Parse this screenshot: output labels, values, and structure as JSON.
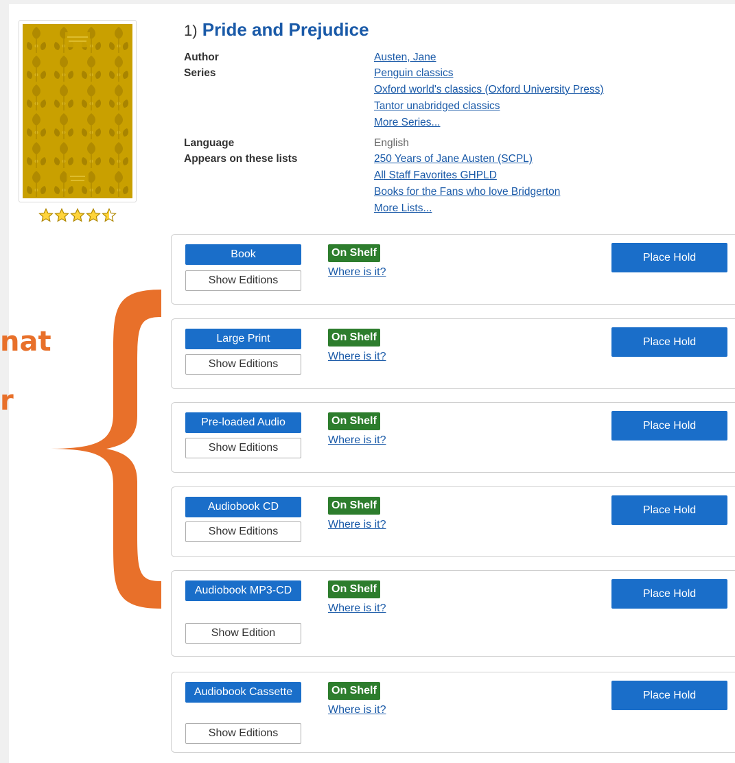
{
  "record": {
    "number": "1)",
    "title": "Pride and Prejudice",
    "rating_stars": 4.5,
    "rating_max": 5
  },
  "metadata": {
    "author_label": "Author",
    "author_value": "Austen, Jane",
    "series_label": "Series",
    "series": [
      "Penguin classics",
      "Oxford world's classics (Oxford University Press)",
      "Tantor unabridged classics"
    ],
    "series_more": "More Series...",
    "language_label": "Language",
    "language_value": "English",
    "lists_label": "Appears on these lists",
    "lists": [
      "250 Years of Jane Austen (SCPL)",
      "All Staff Favorites GHPLD",
      "Books for the Fans who love Bridgerton"
    ],
    "lists_more": "More Lists..."
  },
  "formats": [
    {
      "format": "Book",
      "status": "On Shelf",
      "where": "Where is it?",
      "editions": "Show Editions",
      "hold": "Place Hold"
    },
    {
      "format": "Large Print",
      "status": "On Shelf",
      "where": "Where is it?",
      "editions": "Show Editions",
      "hold": "Place Hold"
    },
    {
      "format": "Pre-loaded Audio",
      "status": "On Shelf",
      "where": "Where is it?",
      "editions": "Show Editions",
      "hold": "Place Hold"
    },
    {
      "format": "Audiobook CD",
      "status": "On Shelf",
      "where": "Where is it?",
      "editions": "Show Editions",
      "hold": "Place Hold"
    },
    {
      "format": "Audiobook MP3-CD",
      "status": "On Shelf",
      "where": "Where is it?",
      "editions": "Show Edition",
      "hold": "Place Hold"
    },
    {
      "format": "Audiobook Cassette",
      "status": "On Shelf",
      "where": "Where is it?",
      "editions": "Show Editions",
      "hold": "Place Hold"
    }
  ],
  "annotation": {
    "line1": "nat",
    "line2": "r",
    "color": "#e8702a"
  },
  "colors": {
    "primary_button": "#1a6ec9",
    "link": "#1a5aa8",
    "on_shelf": "#2d7d2d",
    "cover": "#c9a000"
  }
}
